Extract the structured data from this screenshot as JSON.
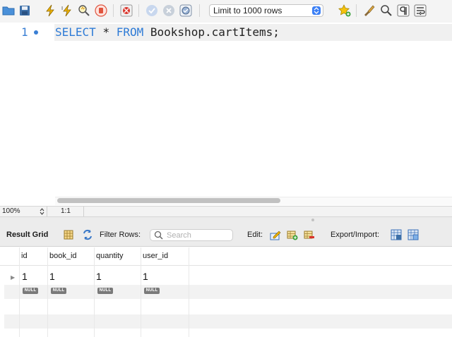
{
  "toolbar": {
    "limit_select": {
      "value": "Limit to 1000 rows"
    }
  },
  "editor": {
    "line_number": "1",
    "keyword_select": "SELECT",
    "star": "*",
    "keyword_from": "FROM",
    "table_ref": "Bookshop.cartItems;"
  },
  "statusbar": {
    "zoom": "100%",
    "cursor": "1:1"
  },
  "result_bar": {
    "title": "Result Grid",
    "filter_label": "Filter Rows:",
    "search_placeholder": "Search",
    "edit_label": "Edit:",
    "export_label": "Export/Import:"
  },
  "grid": {
    "columns": [
      "id",
      "book_id",
      "quantity",
      "user_id"
    ],
    "rows": [
      [
        "1",
        "1",
        "1",
        "1"
      ]
    ],
    "null_label": "NULL"
  },
  "colors": {
    "keyword": "#2e7bd6",
    "line_marker": "#3a7fd4",
    "accent": "#3b7ff5"
  }
}
